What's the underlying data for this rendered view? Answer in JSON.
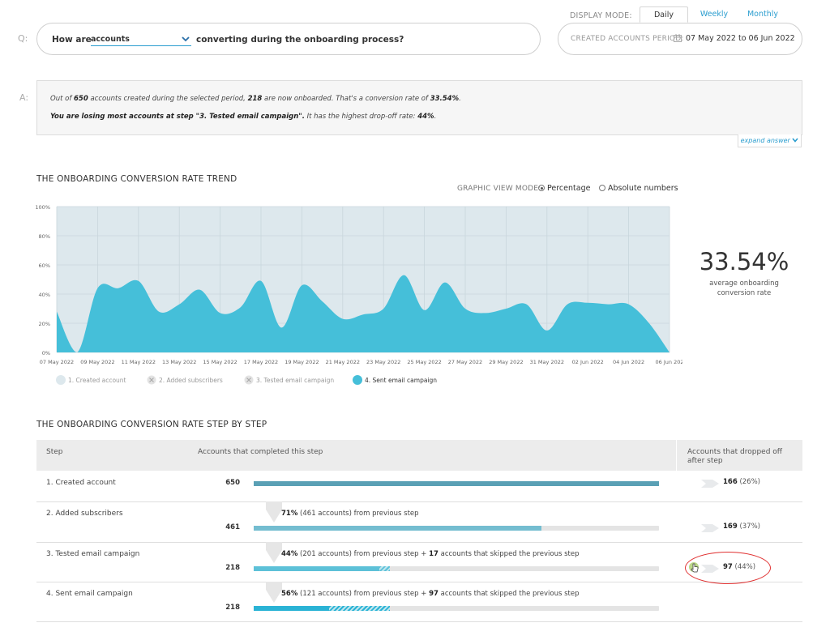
{
  "display_mode": {
    "label": "DISPLAY MODE:",
    "tabs": [
      "Daily",
      "Weekly",
      "Monthly"
    ],
    "active": "Daily"
  },
  "question": {
    "marker": "Q:",
    "prefix": "How are",
    "selected": "accounts",
    "suffix": "converting during the onboarding process?"
  },
  "period": {
    "label": "CREATED ACCOUNTS PERIOD:",
    "value": "07 May 2022 to 06 Jun 2022"
  },
  "answer": {
    "marker": "A:",
    "line1": [
      {
        "t": "Out of "
      },
      {
        "t": "650",
        "b": true
      },
      {
        "t": " accounts created during the selected period, "
      },
      {
        "t": "218",
        "b": true
      },
      {
        "t": " are now onboarded. That's a conversion rate of "
      },
      {
        "t": "33.54%",
        "b": true
      },
      {
        "t": "."
      }
    ],
    "line2": [
      {
        "t": "You are losing most accounts at step \"3. Tested email campaign\".",
        "b": true
      },
      {
        "t": " It has the highest drop-off rate: "
      },
      {
        "t": "44%",
        "b": true
      },
      {
        "t": "."
      }
    ],
    "expand_label": "expand answer"
  },
  "trend": {
    "title": "THE ONBOARDING CONVERSION RATE TREND",
    "view_mode_label": "GRAPHIC VIEW MODE:",
    "view_modes": [
      "Percentage",
      "Absolute numbers"
    ],
    "view_mode_selected": "Percentage",
    "big_value": "33.54%",
    "big_caption": "average onboarding conversion rate"
  },
  "chart_data": {
    "type": "area",
    "y_ticks": [
      "100%",
      "80%",
      "60%",
      "40%",
      "20%",
      "0%"
    ],
    "ylim": [
      0,
      100
    ],
    "x_tick_labels": [
      "07 May 2022",
      "09 May 2022",
      "11 May 2022",
      "13 May 2022",
      "15 May 2022",
      "17 May 2022",
      "19 May 2022",
      "21 May 2022",
      "23 May 2022",
      "25 May 2022",
      "27 May 2022",
      "29 May 2022",
      "31 May 2022",
      "02 Jun 2022",
      "04 Jun 2022",
      "06 Jun 202"
    ],
    "x": [
      "07 May 2022",
      "08 May 2022",
      "09 May 2022",
      "10 May 2022",
      "11 May 2022",
      "12 May 2022",
      "13 May 2022",
      "14 May 2022",
      "15 May 2022",
      "16 May 2022",
      "17 May 2022",
      "18 May 2022",
      "19 May 2022",
      "20 May 2022",
      "21 May 2022",
      "22 May 2022",
      "23 May 2022",
      "24 May 2022",
      "25 May 2022",
      "26 May 2022",
      "27 May 2022",
      "28 May 2022",
      "29 May 2022",
      "30 May 2022",
      "31 May 2022",
      "01 Jun 2022",
      "02 Jun 2022",
      "03 Jun 2022",
      "04 Jun 2022",
      "05 Jun 2022",
      "06 Jun 2022"
    ],
    "series": [
      {
        "name": "4. Sent email campaign",
        "color": "#45bfd9",
        "values": [
          28,
          0,
          44,
          44,
          49,
          28,
          33,
          43,
          27,
          31,
          49,
          17,
          46,
          35,
          23,
          26,
          30,
          53,
          29,
          48,
          30,
          27,
          30,
          33,
          15,
          33,
          34,
          33,
          33,
          20,
          0
        ]
      }
    ],
    "background_area_color": "#dde8ed",
    "grid": true,
    "legend": [
      {
        "label": "1. Created account",
        "color": "#dde8ed",
        "active": false
      },
      {
        "label": "2. Added subscribers",
        "color": "#e0e0e0",
        "active": false
      },
      {
        "label": "3. Tested email campaign",
        "color": "#e0e0e0",
        "active": false
      },
      {
        "label": "4. Sent email campaign",
        "color": "#45bfd9",
        "active": true
      }
    ],
    "legend_position": "bottom-left"
  },
  "steps": {
    "title": "THE ONBOARDING CONVERSION RATE STEP BY STEP",
    "headers": {
      "step": "Step",
      "completed": "Accounts that completed this step",
      "dropped": "Accounts that dropped off after step"
    },
    "rows": [
      {
        "name": "1. Created account",
        "count": "650",
        "fill_fraction": 1.0,
        "fill_color": "#5aa0b5",
        "dropped": "166",
        "dropped_pct": "(26%)"
      },
      {
        "name": "2. Added subscribers",
        "count": "461",
        "fill_fraction": 0.709,
        "fill_color": "#74bdd0",
        "transition_pct": "71%",
        "transition_rest": " (461 accounts) from previous step",
        "dropped": "169",
        "dropped_pct": "(37%)"
      },
      {
        "name": "3. Tested email campaign",
        "count": "218",
        "fill_fraction": 0.309,
        "hatch_fraction": 0.026,
        "fill_color": "#5dc1d8",
        "transition_pct": "44%",
        "transition_rest": " (201 accounts) from previous step + ",
        "transition_skip": "17",
        "transition_skip_rest": " accounts that skipped the previous step",
        "dropped": "97",
        "dropped_pct": "(44%)",
        "highlighted": true
      },
      {
        "name": "4. Sent email campaign",
        "count": "218",
        "fill_fraction": 0.186,
        "hatch_fraction": 0.149,
        "fill_color": "#2ab3d5",
        "transition_pct": "56%",
        "transition_rest": " (121 accounts) from previous step + ",
        "transition_skip": "97",
        "transition_skip_rest": " accounts that skipped the previous step"
      }
    ]
  }
}
